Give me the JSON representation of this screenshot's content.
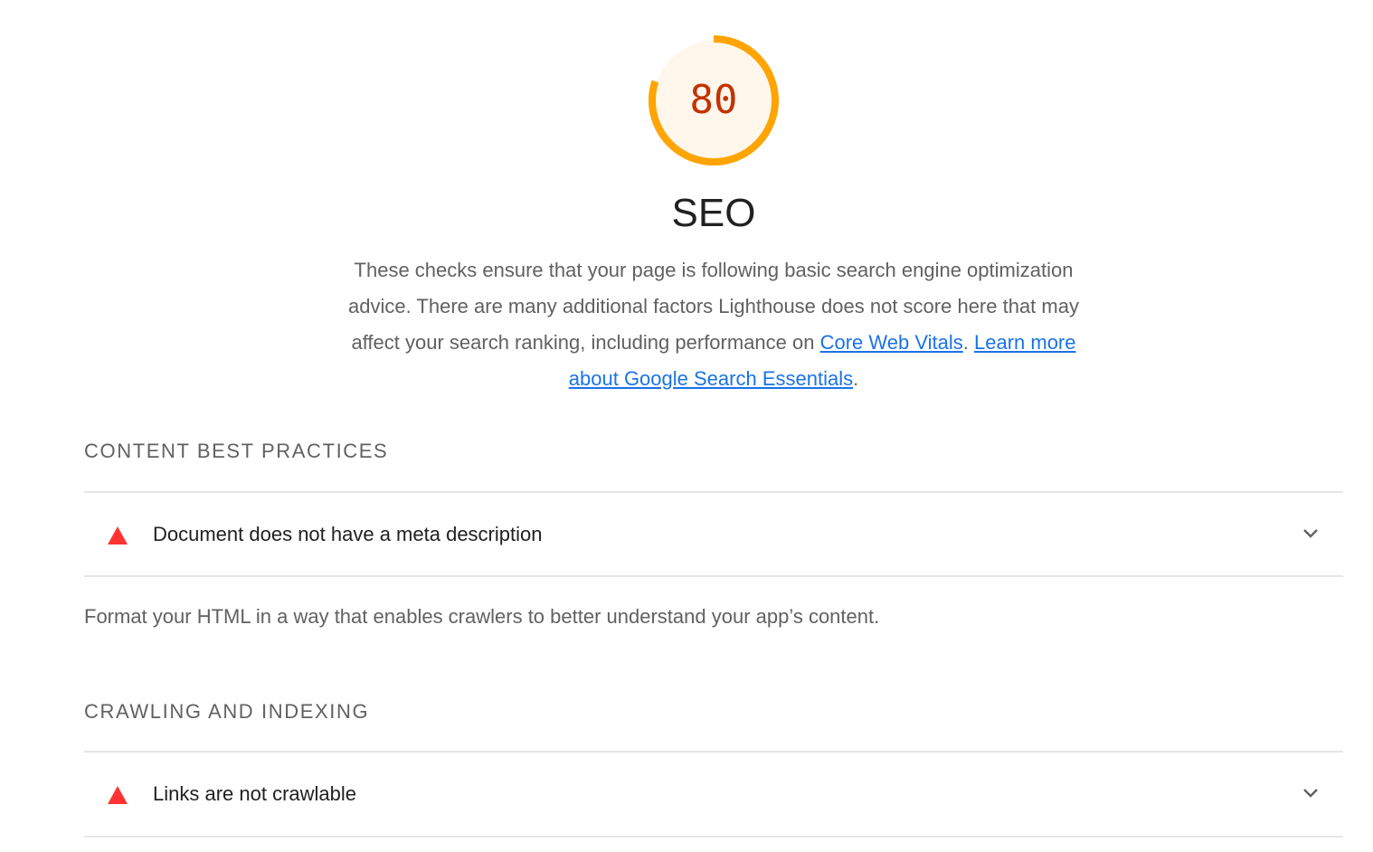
{
  "score": {
    "value": "80",
    "fraction": 0.8,
    "ring_color": "#ffa400",
    "fill_color": "#fff7ec",
    "text_color": "#c33300"
  },
  "category": {
    "title": "SEO",
    "description": "These checks ensure that your page is following basic search engine optimization advice. There are many additional factors Lighthouse does not score here that may affect your search ranking, including performance on ",
    "link1": "Core Web Vitals",
    "sep": ". ",
    "link2": "Learn more about Google Search Essentials",
    "end": "."
  },
  "groups": [
    {
      "heading": "CONTENT BEST PRACTICES",
      "audits": [
        {
          "label": "Document does not have a meta description",
          "status_icon": "fail-triangle-icon",
          "expand_icon": "chevron-down-icon"
        }
      ],
      "description": "Format your HTML in a way that enables crawlers to better understand your app’s content."
    },
    {
      "heading": "CRAWLING AND INDEXING",
      "audits": [
        {
          "label": "Links are not crawlable",
          "status_icon": "fail-triangle-icon",
          "expand_icon": "chevron-down-icon"
        }
      ]
    }
  ],
  "colors": {
    "fail": "#f33",
    "link": "#1a73e8",
    "divider": "#e6e6e6"
  }
}
